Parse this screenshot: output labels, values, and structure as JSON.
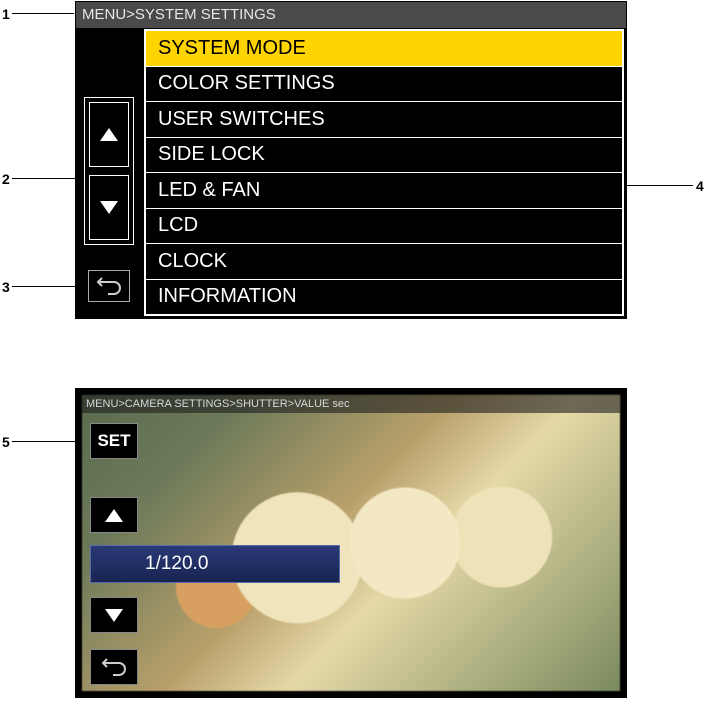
{
  "callouts": {
    "c1": "1",
    "c2": "2",
    "c3": "3",
    "c4": "4",
    "c5": "5"
  },
  "screen1": {
    "breadcrumb": "MENU>SYSTEM SETTINGS",
    "items": [
      {
        "label": "SYSTEM MODE"
      },
      {
        "label": "COLOR SETTINGS"
      },
      {
        "label": "USER SWITCHES"
      },
      {
        "label": "SIDE LOCK"
      },
      {
        "label": "LED & FAN"
      },
      {
        "label": "LCD"
      },
      {
        "label": "CLOCK"
      },
      {
        "label": "INFORMATION"
      }
    ]
  },
  "screen2": {
    "breadcrumb": "MENU>CAMERA SETTINGS>SHUTTER>VALUE sec",
    "set_label": "SET",
    "value": "1/120.0"
  }
}
